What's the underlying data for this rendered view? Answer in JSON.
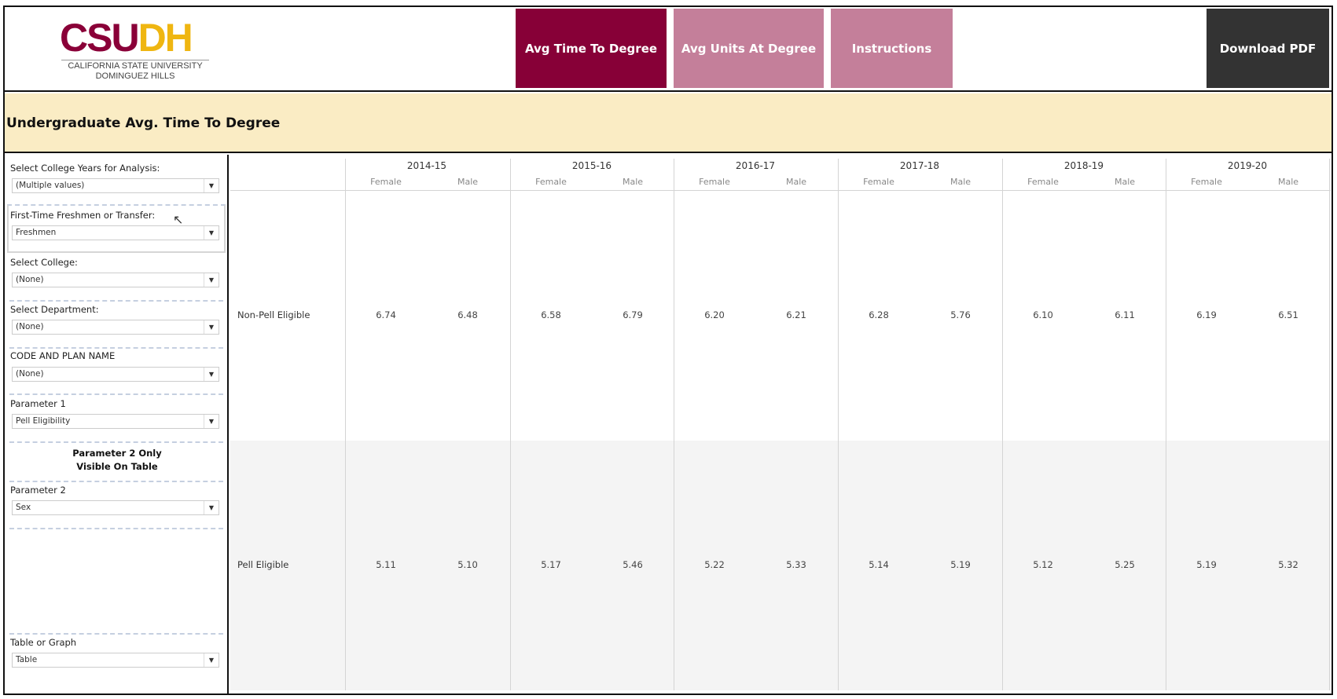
{
  "logo": {
    "text_part1": "CSU",
    "text_part2": "DH",
    "line1": "CALIFORNIA STATE UNIVERSITY",
    "line2": "DOMINGUEZ HILLS"
  },
  "nav": {
    "avg_time": "Avg Time To Degree",
    "avg_units": "Avg Units At Degree",
    "instructions": "Instructions",
    "download": "Download PDF"
  },
  "colors": {
    "active": "#870037",
    "inactive": "#c47f9a",
    "download": "#333333",
    "title_band": "#faecc4"
  },
  "title": "Undergraduate Avg. Time To Degree",
  "filters": [
    {
      "label": "Select College Years for Analysis:",
      "value": "(Multiple values)"
    },
    {
      "label": "First-Time Freshmen or Transfer:",
      "value": "Freshmen"
    },
    {
      "label": "Select College:",
      "value": "(None)"
    },
    {
      "label": "Select Department:",
      "value": "(None)"
    },
    {
      "label": "CODE AND PLAN NAME",
      "value": "(None)"
    },
    {
      "label": "Parameter 1",
      "value": "Pell Eligibility"
    },
    {
      "label": "Parameter 2",
      "value": "Sex"
    },
    {
      "label": "Table or Graph",
      "value": "Table"
    }
  ],
  "note": {
    "line1": "Parameter 2 Only",
    "line2": "Visible On Table"
  },
  "table": {
    "years": [
      "2014-15",
      "2015-16",
      "2016-17",
      "2017-18",
      "2018-19",
      "2019-20"
    ],
    "sexes": [
      "Female",
      "Male"
    ],
    "rows": [
      {
        "label": "Non-Pell Eligible",
        "values": [
          "6.74",
          "6.48",
          "6.58",
          "6.79",
          "6.20",
          "6.21",
          "6.28",
          "5.76",
          "6.10",
          "6.11",
          "6.19",
          "6.51"
        ]
      },
      {
        "label": "Pell Eligible",
        "values": [
          "5.11",
          "5.10",
          "5.17",
          "5.46",
          "5.22",
          "5.33",
          "5.14",
          "5.19",
          "5.12",
          "5.25",
          "5.19",
          "5.32"
        ]
      }
    ]
  }
}
